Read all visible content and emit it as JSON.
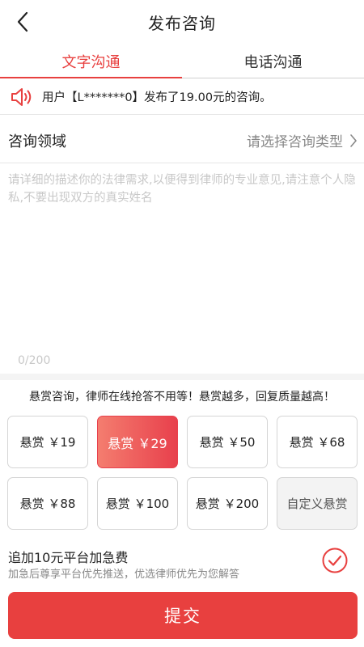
{
  "header": {
    "title": "发布咨询"
  },
  "tabs": [
    {
      "label": "文字沟通",
      "active": true
    },
    {
      "label": "电话沟通",
      "active": false
    }
  ],
  "notice": {
    "text": "用户【L*******0】发布了19.00元的咨询。",
    "icon": "speaker-icon"
  },
  "domain": {
    "label": "咨询领域",
    "value": "请选择咨询类型"
  },
  "description": {
    "placeholder": "请详细的描述你的法律需求,以便得到律师的专业意见,请注意个人隐私,不要出现双方的真实姓名",
    "value": "",
    "counter": "0/200"
  },
  "reward": {
    "tip": "悬赏咨询，律师在线抢答不用等！悬赏越多，回复质量越高！",
    "options": [
      {
        "label": "悬赏 ￥19",
        "selected": false
      },
      {
        "label": "悬赏 ￥29",
        "selected": true
      },
      {
        "label": "悬赏 ￥50",
        "selected": false
      },
      {
        "label": "悬赏 ￥68",
        "selected": false
      },
      {
        "label": "悬赏 ￥88",
        "selected": false
      },
      {
        "label": "悬赏 ￥100",
        "selected": false
      },
      {
        "label": "悬赏 ￥200",
        "selected": false
      },
      {
        "label": "自定义悬赏",
        "selected": false
      }
    ]
  },
  "urgent": {
    "title": "追加10元平台加急费",
    "description": "加急后尊享平台优先推送，优选律师优先为您解答",
    "checked": true
  },
  "submit": {
    "label": "提交"
  },
  "colors": {
    "accent": "#e8403f",
    "selected_gradient_start": "#f47d6f",
    "selected_gradient_end": "#e8404c"
  }
}
